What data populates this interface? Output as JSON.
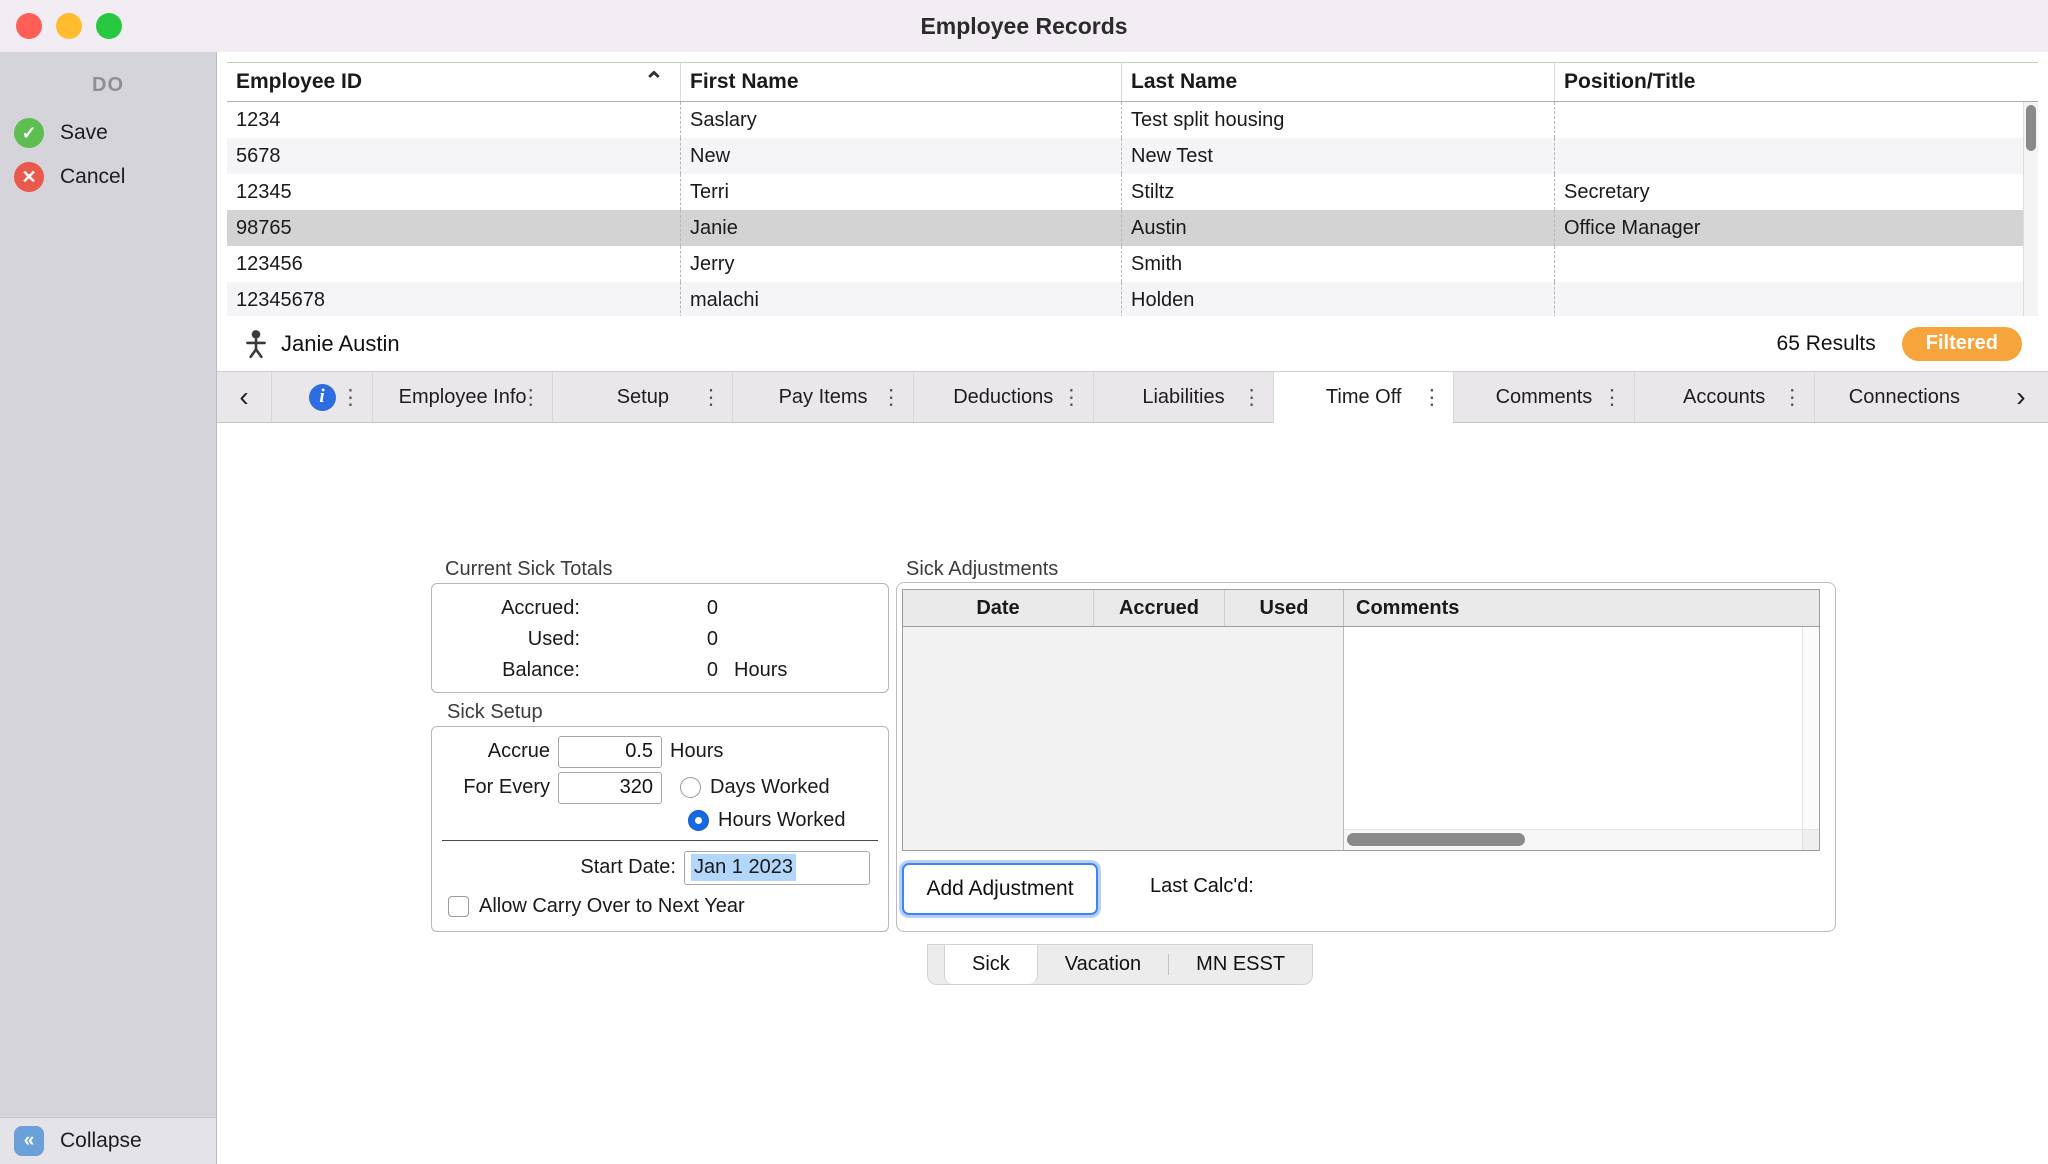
{
  "window": {
    "title": "Employee Records"
  },
  "sidebar": {
    "header": "DO",
    "save_label": "Save",
    "cancel_label": "Cancel",
    "collapse_label": "Collapse"
  },
  "glyphs": {
    "check": "✓",
    "close": "✕",
    "collapse": "«",
    "chevron_left": "‹",
    "chevron_right": "›",
    "sort_asc": "⌃",
    "menu_dots": "⋮",
    "info": "i"
  },
  "employee_table": {
    "columns": [
      "Employee ID",
      "First Name",
      "Last Name",
      "Position/Title"
    ],
    "rows": [
      {
        "id": "1234",
        "first_name": "Saslary",
        "last_name": "Test split housing",
        "position": ""
      },
      {
        "id": "5678",
        "first_name": "New",
        "last_name": "New Test",
        "position": ""
      },
      {
        "id": "12345",
        "first_name": "Terri",
        "last_name": "Stiltz",
        "position": "Secretary"
      },
      {
        "id": "98765",
        "first_name": "Janie",
        "last_name": "Austin",
        "position": "Office Manager"
      },
      {
        "id": "123456",
        "first_name": "Jerry",
        "last_name": "Smith",
        "position": ""
      },
      {
        "id": "12345678",
        "first_name": "malachi",
        "last_name": "Holden",
        "position": ""
      }
    ],
    "selected_row_id": "98765"
  },
  "record_bar": {
    "name": "Janie Austin",
    "results": "65 Results",
    "filtered_badge": "Filtered"
  },
  "tabs": {
    "items": [
      "Employee Info",
      "Setup",
      "Pay Items",
      "Deductions",
      "Liabilities",
      "Time Off",
      "Comments",
      "Accounts",
      "Connections"
    ],
    "active": "Time Off"
  },
  "time_off": {
    "totals": {
      "title": "Current Sick Totals",
      "rows": [
        {
          "label": "Accrued:",
          "value": "0",
          "unit": ""
        },
        {
          "label": "Used:",
          "value": "0",
          "unit": ""
        },
        {
          "label": "Balance:",
          "value": "0",
          "unit": "Hours"
        }
      ]
    },
    "setup": {
      "title": "Sick Setup",
      "accrue_label": "Accrue",
      "accrue_value": "0.5",
      "accrue_unit": "Hours",
      "for_every_label": "For Every",
      "for_every_value": "320",
      "radio_days_label": "Days Worked",
      "radio_hours_label": "Hours Worked",
      "selected_radio": "Hours Worked",
      "start_date_label": "Start Date:",
      "start_date_value": "Jan 1 2023",
      "carry_over_label": "Allow Carry Over to Next Year"
    },
    "adjustments": {
      "title": "Sick Adjustments",
      "columns": [
        "Date",
        "Accrued",
        "Used",
        "Comments"
      ],
      "add_button_label": "Add Adjustment",
      "last_calcd_label": "Last Calc'd:"
    },
    "bottom_tabs": {
      "items": [
        "Sick",
        "Vacation",
        "MN ESST"
      ],
      "active": "Sick"
    }
  },
  "colors": {
    "filtered_badge": "#F7A43C",
    "save_green": "#5FBE51",
    "cancel_red": "#E9594C",
    "radio_blue": "#1668E3",
    "focus_ring": "#3F83F7",
    "selection_highlight": "#B3D7FB",
    "collapse_blue": "#6A9FD8",
    "traffic_red": "#FF5F57",
    "traffic_yellow": "#FEBC2E",
    "traffic_green": "#28C840"
  }
}
